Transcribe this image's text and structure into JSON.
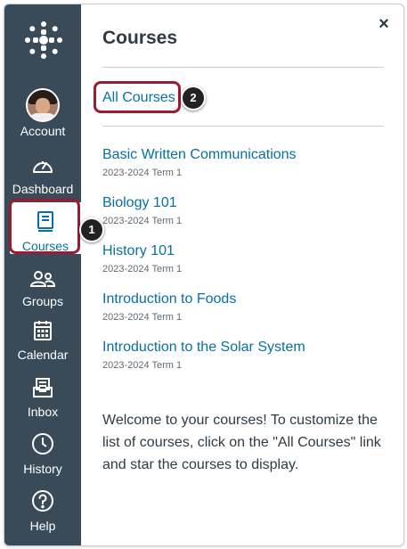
{
  "sidebar": {
    "logo_icon": "canvas-logo-icon",
    "items": [
      {
        "name": "account",
        "label": "Account",
        "icon": "avatar"
      },
      {
        "name": "dashboard",
        "label": "Dashboard",
        "icon": "speedometer-icon"
      },
      {
        "name": "courses",
        "label": "Courses",
        "icon": "book-icon",
        "active": true
      },
      {
        "name": "groups",
        "label": "Groups",
        "icon": "people-icon"
      },
      {
        "name": "calendar",
        "label": "Calendar",
        "icon": "calendar-icon"
      },
      {
        "name": "inbox",
        "label": "Inbox",
        "icon": "inbox-icon"
      },
      {
        "name": "history",
        "label": "History",
        "icon": "clock-icon"
      },
      {
        "name": "help",
        "label": "Help",
        "icon": "question-icon"
      }
    ]
  },
  "callouts": {
    "one": "1",
    "two": "2"
  },
  "panel": {
    "title": "Courses",
    "close_label": "×",
    "all_courses_label": "All Courses",
    "courses": [
      {
        "name": "Basic Written Communications",
        "term": "2023-2024 Term 1"
      },
      {
        "name": "Biology 101",
        "term": "2023-2024 Term 1"
      },
      {
        "name": "History 101",
        "term": "2023-2024 Term 1"
      },
      {
        "name": "Introduction to Foods",
        "term": "2023-2024 Term 1"
      },
      {
        "name": "Introduction to the Solar System",
        "term": "2023-2024 Term 1"
      }
    ],
    "welcome_text": "Welcome to your courses! To customize the list of courses, click on the \"All Courses\" link and star the courses to display."
  },
  "colors": {
    "sidebar_bg": "#394b58",
    "link": "#0770a3",
    "highlight": "#9b1b30",
    "text": "#2d3b45"
  }
}
